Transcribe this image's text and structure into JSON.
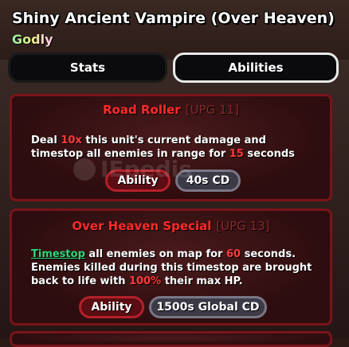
{
  "unit": {
    "name": "Shiny Ancient Vampire (Over Heaven)",
    "rarity": "Godly"
  },
  "tabs": [
    {
      "label": "Stats",
      "active": false
    },
    {
      "label": "Abilities",
      "active": true
    }
  ],
  "abilities": [
    {
      "name": "Road Roller",
      "upgrade": "[UPG 11]",
      "desc": {
        "p1": "Deal ",
        "mult": "10x",
        "p2": " this unit's current damage and timestop all enemies in range for ",
        "secs": "15",
        "p3": " seconds"
      },
      "type_label": "Ability",
      "cooldown": "40s CD"
    },
    {
      "name": "Over Heaven Special",
      "upgrade": "[UPG 13]",
      "desc": {
        "link": "Timestop",
        "p1": " all enemies on map for ",
        "secs": "60",
        "p2": " seconds. Enemies killed during this timestop are brought back to life with ",
        "pct": "100%",
        "p3": " their max HP."
      },
      "type_label": "Ability",
      "cooldown": "1500s Global CD"
    }
  ],
  "watermark": "IEpedis",
  "colors": {
    "accent_red": "#ff2b2b",
    "card_border": "#7a1418",
    "link_green": "#2ed87a"
  }
}
